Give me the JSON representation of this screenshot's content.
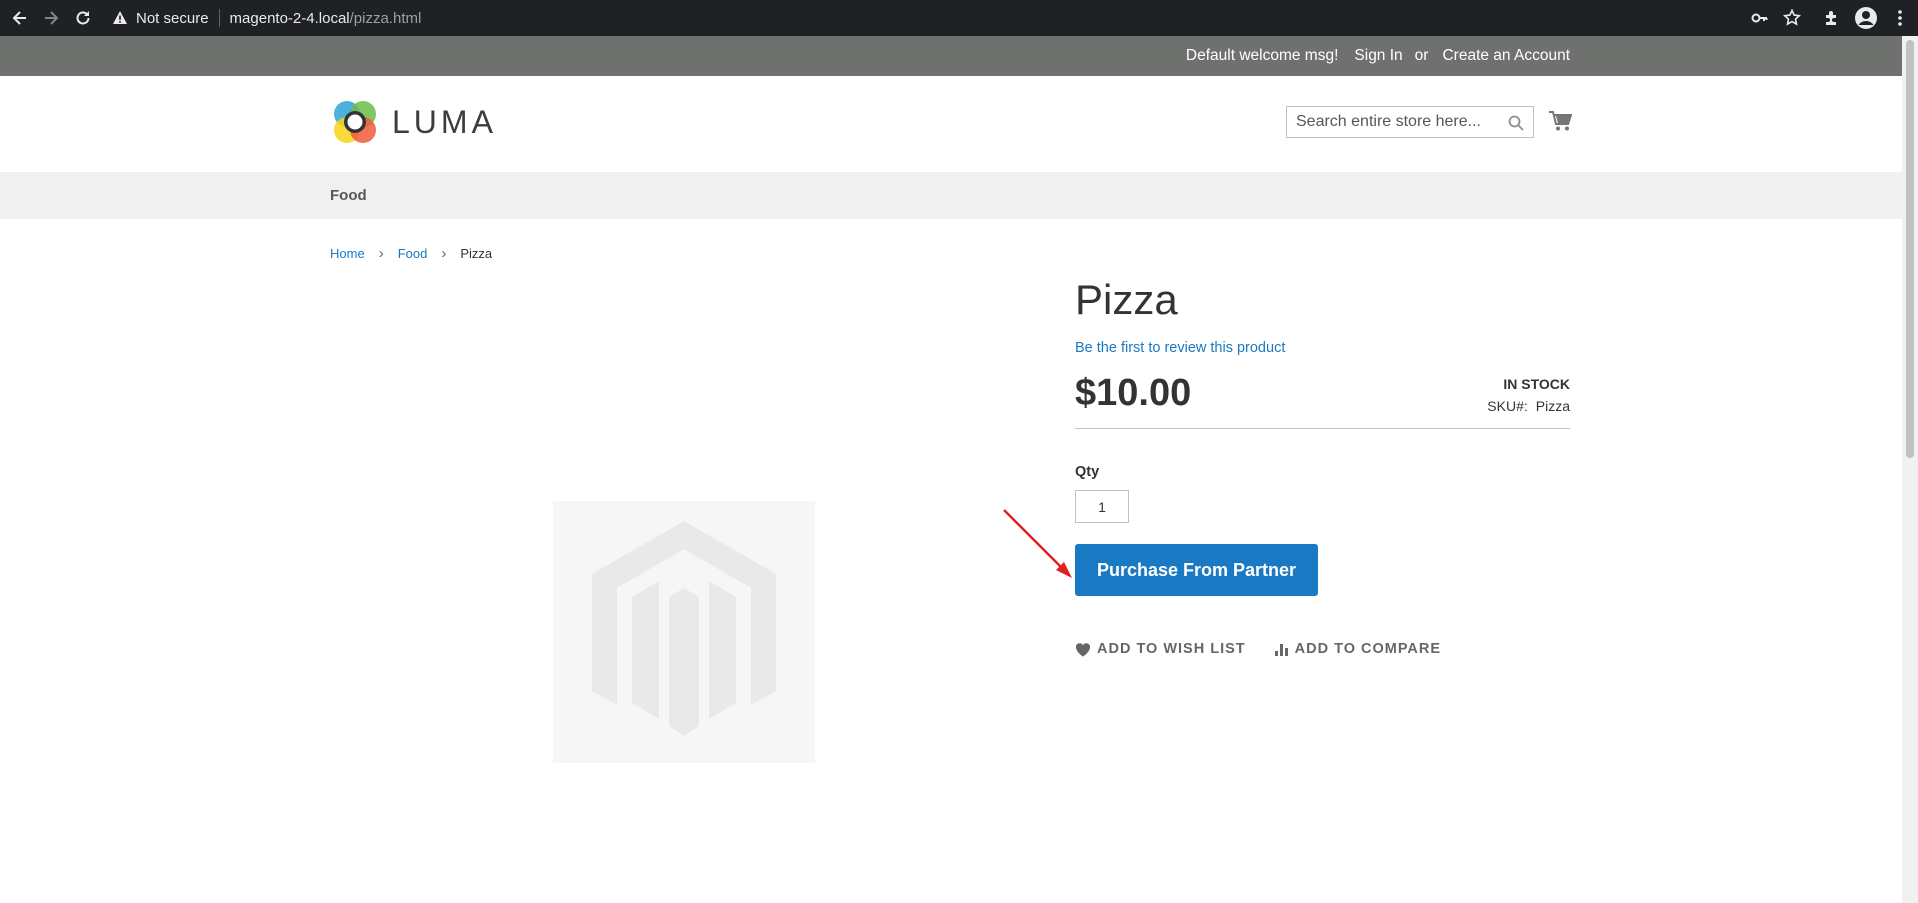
{
  "browser": {
    "security_label": "Not secure",
    "url_host": "magento-2-4.local",
    "url_path": "/pizza.html"
  },
  "header": {
    "welcome": "Default welcome msg!",
    "sign_in": "Sign In",
    "or": "or",
    "create_account": "Create an Account"
  },
  "logo": {
    "text": "LUMA"
  },
  "search": {
    "placeholder": "Search entire store here..."
  },
  "nav": {
    "items": [
      "Food"
    ]
  },
  "breadcrumbs": {
    "home": "Home",
    "category": "Food",
    "current": "Pizza",
    "separator": "›"
  },
  "product": {
    "name": "Pizza",
    "review_link": "Be the first to review this product",
    "price": "$10.00",
    "stock_status": "IN STOCK",
    "sku_label": "SKU#:",
    "sku_value": "Pizza",
    "qty_label": "Qty",
    "qty_value": "1",
    "purchase_button": "Purchase From Partner",
    "wishlist": "ADD TO WISH LIST",
    "compare": "ADD TO COMPARE"
  },
  "colors": {
    "accent": "#1979c3",
    "panel_header": "#6e716e",
    "annotation_arrow": "#e02020"
  }
}
